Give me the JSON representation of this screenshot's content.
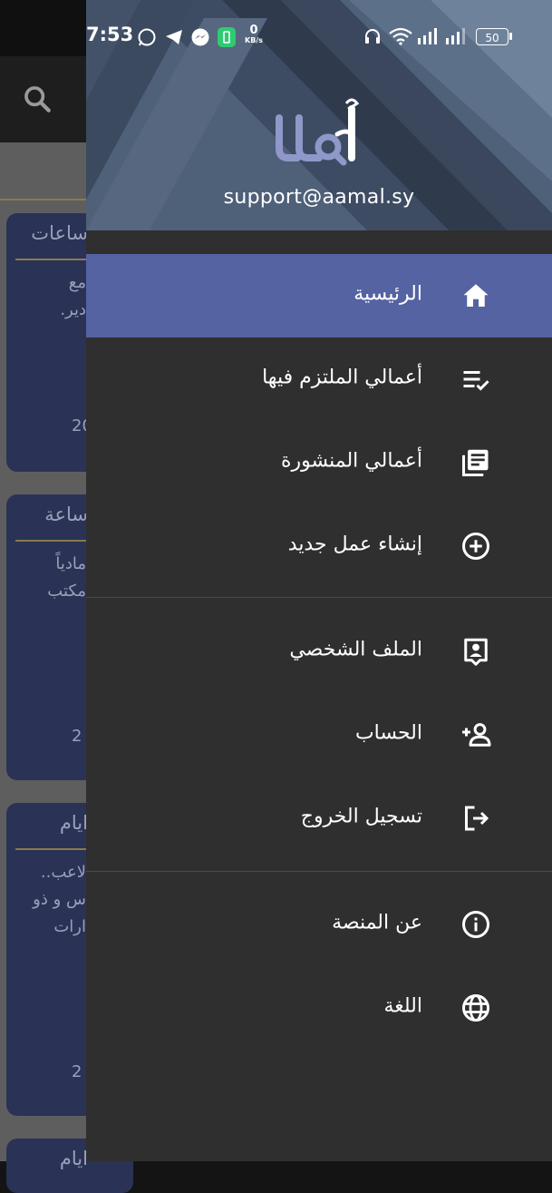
{
  "status_bar": {
    "time": "7:53",
    "network_speed_value": "0",
    "network_speed_unit": "KB/s",
    "battery_level": "50"
  },
  "drawer": {
    "email": "support@aamal.sy",
    "logo_text": "أعمال",
    "menu": [
      {
        "label": "الرئيسية",
        "icon": "home-icon"
      },
      {
        "label": "أعمالي الملتزم فيها",
        "icon": "checklist-icon"
      },
      {
        "label": "أعمالي المنشورة",
        "icon": "articles-icon"
      },
      {
        "label": "إنشاء عمل جديد",
        "icon": "add-circle-icon"
      },
      {
        "label": "الملف الشخصي",
        "icon": "profile-icon"
      },
      {
        "label": "الحساب",
        "icon": "person-add-icon"
      },
      {
        "label": "تسجيل الخروج",
        "icon": "logout-icon"
      },
      {
        "label": "عن المنصة",
        "icon": "info-icon"
      },
      {
        "label": "اللغة",
        "icon": "language-icon"
      }
    ]
  },
  "background_list": {
    "cards": [
      {
        "header": "ساعات",
        "lines": [
          "مع",
          "دير."
        ],
        "year": "20"
      },
      {
        "header": "ساعة",
        "lines": [
          "مادياً",
          "مكتب"
        ],
        "year": "2"
      },
      {
        "header": "ايام",
        "lines": [
          "لاعب..",
          "س و ذو",
          "ارات"
        ],
        "year": "2"
      },
      {
        "header": "ايام",
        "lines": [],
        "year": ""
      }
    ]
  },
  "colors": {
    "drawer_bg": "#2f2f2f",
    "active_item": "#5563a3",
    "card_bg": "#2a3256",
    "gold_rule": "#8a7a4c"
  }
}
